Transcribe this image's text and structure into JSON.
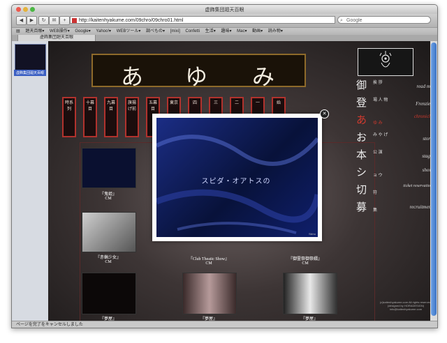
{
  "window": {
    "title": "虚飾集団廻天百眼"
  },
  "toolbar": {
    "back_label": "◀",
    "forward_label": "▶",
    "reload_label": "↻",
    "mail_label": "✉",
    "add_label": "+",
    "url": "http://kaitenhyakume.com/09chro/09chro01.html",
    "search_placeholder": "Google"
  },
  "bookmarks": {
    "items": [
      "廻天百眼▾",
      "WEB操作▾",
      "Google▾",
      "Yahoo!▾",
      "WEBツール▾",
      "調べもの▾",
      "[mixi]",
      "Confetti",
      "生活▾",
      "趣味▾",
      "Mac▾",
      "動画▾",
      "読み物▾"
    ]
  },
  "tab": {
    "label": "虚飾集団廻天百眼"
  },
  "sidebar": {
    "thumb_label": "虚飾集団廻天百眼"
  },
  "page": {
    "banner": {
      "chars": [
        "あ",
        "ゆ",
        "み"
      ]
    },
    "bars": [
      "時系列",
      "十幕目",
      "九幕目",
      "旗揚げ前",
      "五幕目",
      "東京",
      "四",
      "三",
      "二",
      "一",
      "始"
    ],
    "captions": {
      "c1_title": "『鬼姫』",
      "c1_sub": "CM",
      "c2_title": "『赤蝋少女』",
      "c2_sub": "CM",
      "c3_title": "『Club Theatic Show』",
      "c3_sub": "CM",
      "c4_title": "『御霊祭御祭綴』",
      "c4_sub": "CM",
      "c5_title": "『夢屋』",
      "c6_title": "『夢屋』",
      "c7_title": "『夢屋』"
    },
    "credits": {
      "line1": "(c)kaitenhyakume.com All rights reserved.",
      "line2": "(designed by HORADESIGN)",
      "line3": "info@kaitenhyakume.com"
    }
  },
  "menu": {
    "items": [
      {
        "jp": "御",
        "kana": "挨 拶",
        "en": "read me"
      },
      {
        "jp": "登",
        "kana": "場 人 物",
        "en": "Frenzies"
      },
      {
        "jp": "あ",
        "kana": "ゆ み",
        "en": "chronicle"
      },
      {
        "jp": "お",
        "kana": "み や げ",
        "en": "store"
      },
      {
        "jp": "本",
        "kana": "公 演",
        "en": "stage"
      },
      {
        "jp": "シ",
        "kana": "ョ ウ",
        "en": "show"
      },
      {
        "jp": "切",
        "kana": "符",
        "en": "ticket reservation"
      },
      {
        "jp": "募",
        "kana": "集",
        "en": "recruitment"
      }
    ]
  },
  "overlay": {
    "video_text": "スピダ・オアトスの",
    "video_corner": "Sikho",
    "close_label": "✕"
  },
  "status": {
    "text": "ページを完了をキャンセルしました"
  },
  "colors": {
    "accent_red": "#c0392b",
    "menu_active": "#d23a2e"
  }
}
